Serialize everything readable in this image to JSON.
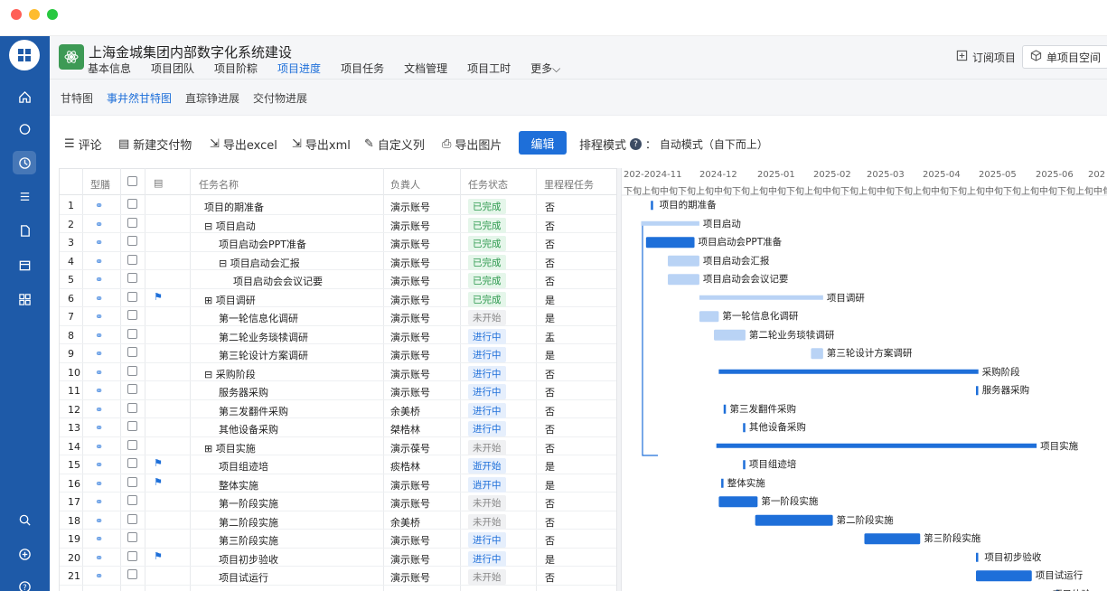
{
  "window": {
    "dots": [
      "#ff5f57",
      "#febc2e",
      "#28c840"
    ]
  },
  "sidebar": {
    "logo": "building-logo",
    "icons": [
      "home-icon",
      "chat-icon",
      "project-icon",
      "list-icon",
      "document-icon",
      "calendar-icon",
      "apps-icon",
      "search-icon",
      "add-icon",
      "help-icon"
    ],
    "active_index": 2
  },
  "header": {
    "title": "上海金城集团内部数字化系统建设",
    "tabs": [
      "基本信息",
      "项目团队",
      "项目阶粽",
      "项目进度",
      "项目任务",
      "文档管理",
      "项目工时",
      "更多"
    ],
    "active_tab": "项目进度",
    "subscribe": "订阅项目",
    "single_space": "单项目空间"
  },
  "subtabs": {
    "items": [
      "甘特图",
      "事井然甘特图",
      "直琮铮进展",
      "交付物进展"
    ],
    "active": "事井然甘特图"
  },
  "toolbar": {
    "comment": "评论",
    "new_deliverable": "新建交付物",
    "export_excel": "导出excel",
    "export_xml": "导出xml",
    "custom_columns": "自定义列",
    "export_image": "导出图片",
    "edit": "编辑",
    "schedule_mode_label": "排程模式",
    "schedule_mode_value": "：  自动模式（自下而上）"
  },
  "grid": {
    "columns": [
      "型膳",
      "",
      "",
      "任务名称",
      "负粪人",
      "任务状态",
      "里程程任务"
    ],
    "rows": [
      {
        "no": "1",
        "name": "项目的期准备",
        "indent": 0,
        "expander": "",
        "owner": "演示账号",
        "status": "已完成",
        "status_type": "done",
        "milestone": "否",
        "flag": false
      },
      {
        "no": "2",
        "name": "项目启动",
        "indent": 0,
        "expander": "⊟",
        "owner": "演示账号",
        "status": "已完成",
        "status_type": "done",
        "milestone": "否",
        "flag": false
      },
      {
        "no": "3",
        "name": "项目启动会PPT准备",
        "indent": 1,
        "expander": "",
        "owner": "演示账号",
        "status": "已完成",
        "status_type": "done",
        "milestone": "否",
        "flag": false
      },
      {
        "no": "4",
        "name": "项目启动会汇报",
        "indent": 1,
        "expander": "⊟",
        "owner": "演示账号",
        "status": "已完成",
        "status_type": "done",
        "milestone": "否",
        "flag": false
      },
      {
        "no": "5",
        "name": "项目启动会会议记要",
        "indent": 2,
        "expander": "",
        "owner": "演示账号",
        "status": "已完成",
        "status_type": "done",
        "milestone": "否",
        "flag": false
      },
      {
        "no": "6",
        "name": "项目调研",
        "indent": 0,
        "expander": "⊞",
        "owner": "演示账号",
        "status": "已完成",
        "status_type": "done",
        "milestone": "是",
        "flag": true
      },
      {
        "no": "7",
        "name": "第一轮信息化调研",
        "indent": 1,
        "expander": "",
        "owner": "演示账号",
        "status": "未开始",
        "status_type": "todo",
        "milestone": "是",
        "flag": false
      },
      {
        "no": "8",
        "name": "第二轮业务琰犊调研",
        "indent": 1,
        "expander": "",
        "owner": "演示账号",
        "status": "进行中",
        "status_type": "doing",
        "milestone": "盂",
        "flag": false
      },
      {
        "no": "9",
        "name": "第三轮设计方案调研",
        "indent": 1,
        "expander": "",
        "owner": "演示账号",
        "status": "进行中",
        "status_type": "doing",
        "milestone": "是",
        "flag": false
      },
      {
        "no": "10",
        "name": "采购阶段",
        "indent": 0,
        "expander": "⊟",
        "owner": "演示账号",
        "status": "进行中",
        "status_type": "doing",
        "milestone": "否",
        "flag": false
      },
      {
        "no": "11",
        "name": "服务器采购",
        "indent": 1,
        "expander": "",
        "owner": "演示账号",
        "status": "进行中",
        "status_type": "doing",
        "milestone": "否",
        "flag": false
      },
      {
        "no": "12",
        "name": "第三发翻件采购",
        "indent": 1,
        "expander": "",
        "owner": "余美桥",
        "status": "进行中",
        "status_type": "doing",
        "milestone": "否",
        "flag": false
      },
      {
        "no": "13",
        "name": "其他设备采购",
        "indent": 1,
        "expander": "",
        "owner": "桀梏林",
        "status": "进行中",
        "status_type": "doing",
        "milestone": "否",
        "flag": false
      },
      {
        "no": "14",
        "name": "项目实施",
        "indent": 0,
        "expander": "⊞",
        "owner": "演示葆号",
        "status": "未开始",
        "status_type": "todo",
        "milestone": "否",
        "flag": false
      },
      {
        "no": "15",
        "name": "项目组迹培",
        "indent": 1,
        "expander": "",
        "owner": "痰梏林",
        "status": "逝开始",
        "status_type": "doing",
        "milestone": "是",
        "flag": true
      },
      {
        "no": "16",
        "name": "整体实施",
        "indent": 1,
        "expander": "",
        "owner": "演示账号",
        "status": "逍开中",
        "status_type": "doing",
        "milestone": "是",
        "flag": true
      },
      {
        "no": "17",
        "name": "第一阶段实施",
        "indent": 1,
        "expander": "",
        "owner": "演示账号",
        "status": "未开始",
        "status_type": "todo",
        "milestone": "否",
        "flag": false
      },
      {
        "no": "18",
        "name": "第二阶段实施",
        "indent": 1,
        "expander": "",
        "owner": "余美桥",
        "status": "未开始",
        "status_type": "todo",
        "milestone": "否",
        "flag": false
      },
      {
        "no": "19",
        "name": "第三阶段实施",
        "indent": 1,
        "expander": "",
        "owner": "演示账号",
        "status": "进行中",
        "status_type": "doing",
        "milestone": "否",
        "flag": false
      },
      {
        "no": "20",
        "name": "项目初步验收",
        "indent": 1,
        "expander": "",
        "owner": "演示账号",
        "status": "进行中",
        "status_type": "doing",
        "milestone": "是",
        "flag": true
      },
      {
        "no": "21",
        "name": "项目试运行",
        "indent": 1,
        "expander": "",
        "owner": "演示账号",
        "status": "未开始",
        "status_type": "todo",
        "milestone": "否",
        "flag": false
      }
    ]
  },
  "gantt": {
    "months": [
      "202-2024-11",
      "2024-12",
      "2025-01",
      "2025-02",
      "2025-03",
      "2025-04",
      "2025-05",
      "2025-06",
      "202"
    ],
    "xun_row": "下旬上旬中旬下旬上旬中旬下旬上旬中旬下旬上旬中旬下旬上旬中旬下旬上旬中旬下旬上旬中旬下旬上旬中旬下旬上旬中旬下旬上旬",
    "bar_color": "#1e6fd9",
    "light_bar_color": "#b9d3f5",
    "tasks": [
      {
        "label": "项目的期准备",
        "start": 0.06,
        "end": 0.07,
        "kind": "milestone",
        "done": true
      },
      {
        "label": "项目启动",
        "start": 0.04,
        "end": 0.16,
        "kind": "summary",
        "done": true
      },
      {
        "label": "项目启动会PPT准备",
        "start": 0.05,
        "end": 0.15,
        "kind": "bar",
        "done": false
      },
      {
        "label": "项目启动会汇报",
        "start": 0.095,
        "end": 0.16,
        "kind": "bar",
        "done": true
      },
      {
        "label": "项目启动会会议记要",
        "start": 0.095,
        "end": 0.16,
        "kind": "bar",
        "done": true
      },
      {
        "label": "项目调研",
        "start": 0.16,
        "end": 0.415,
        "kind": "summary",
        "done": true
      },
      {
        "label": "第一轮信息化调研",
        "start": 0.16,
        "end": 0.2,
        "kind": "bar",
        "done": true
      },
      {
        "label": "第二轮业务琰犊调研",
        "start": 0.19,
        "end": 0.255,
        "kind": "bar",
        "done": true
      },
      {
        "label": "第三轮设计方案调研",
        "start": 0.39,
        "end": 0.415,
        "kind": "bar",
        "done": true
      },
      {
        "label": "采购阶段",
        "start": 0.2,
        "end": 0.735,
        "kind": "summary",
        "done": false
      },
      {
        "label": "服务器采购",
        "start": 0.73,
        "end": 0.735,
        "kind": "milestone",
        "done": false
      },
      {
        "label": "第三发翻件采购",
        "start": 0.21,
        "end": 0.215,
        "kind": "milestone",
        "done": false
      },
      {
        "label": "其他设备采购",
        "start": 0.25,
        "end": 0.255,
        "kind": "milestone",
        "done": false
      },
      {
        "label": "项目实施",
        "start": 0.195,
        "end": 0.855,
        "kind": "summary",
        "done": false
      },
      {
        "label": "项目组迹培",
        "start": 0.25,
        "end": 0.255,
        "kind": "milestone",
        "done": false
      },
      {
        "label": "整体实施",
        "start": 0.205,
        "end": 0.21,
        "kind": "milestone",
        "done": false
      },
      {
        "label": "第一阶段实施",
        "start": 0.2,
        "end": 0.28,
        "kind": "bar",
        "done": false
      },
      {
        "label": "第二阶段实施",
        "start": 0.275,
        "end": 0.435,
        "kind": "bar",
        "done": false
      },
      {
        "label": "第三阶段实施",
        "start": 0.5,
        "end": 0.615,
        "kind": "bar",
        "done": false
      },
      {
        "label": "项目初步验收",
        "start": 0.73,
        "end": 0.74,
        "kind": "milestone",
        "done": false
      },
      {
        "label": "项目试运行",
        "start": 0.73,
        "end": 0.845,
        "kind": "bar",
        "done": false
      },
      {
        "label": "项目体验",
        "start": 0.895,
        "end": 0.9,
        "kind": "milestone",
        "done": false
      }
    ]
  }
}
